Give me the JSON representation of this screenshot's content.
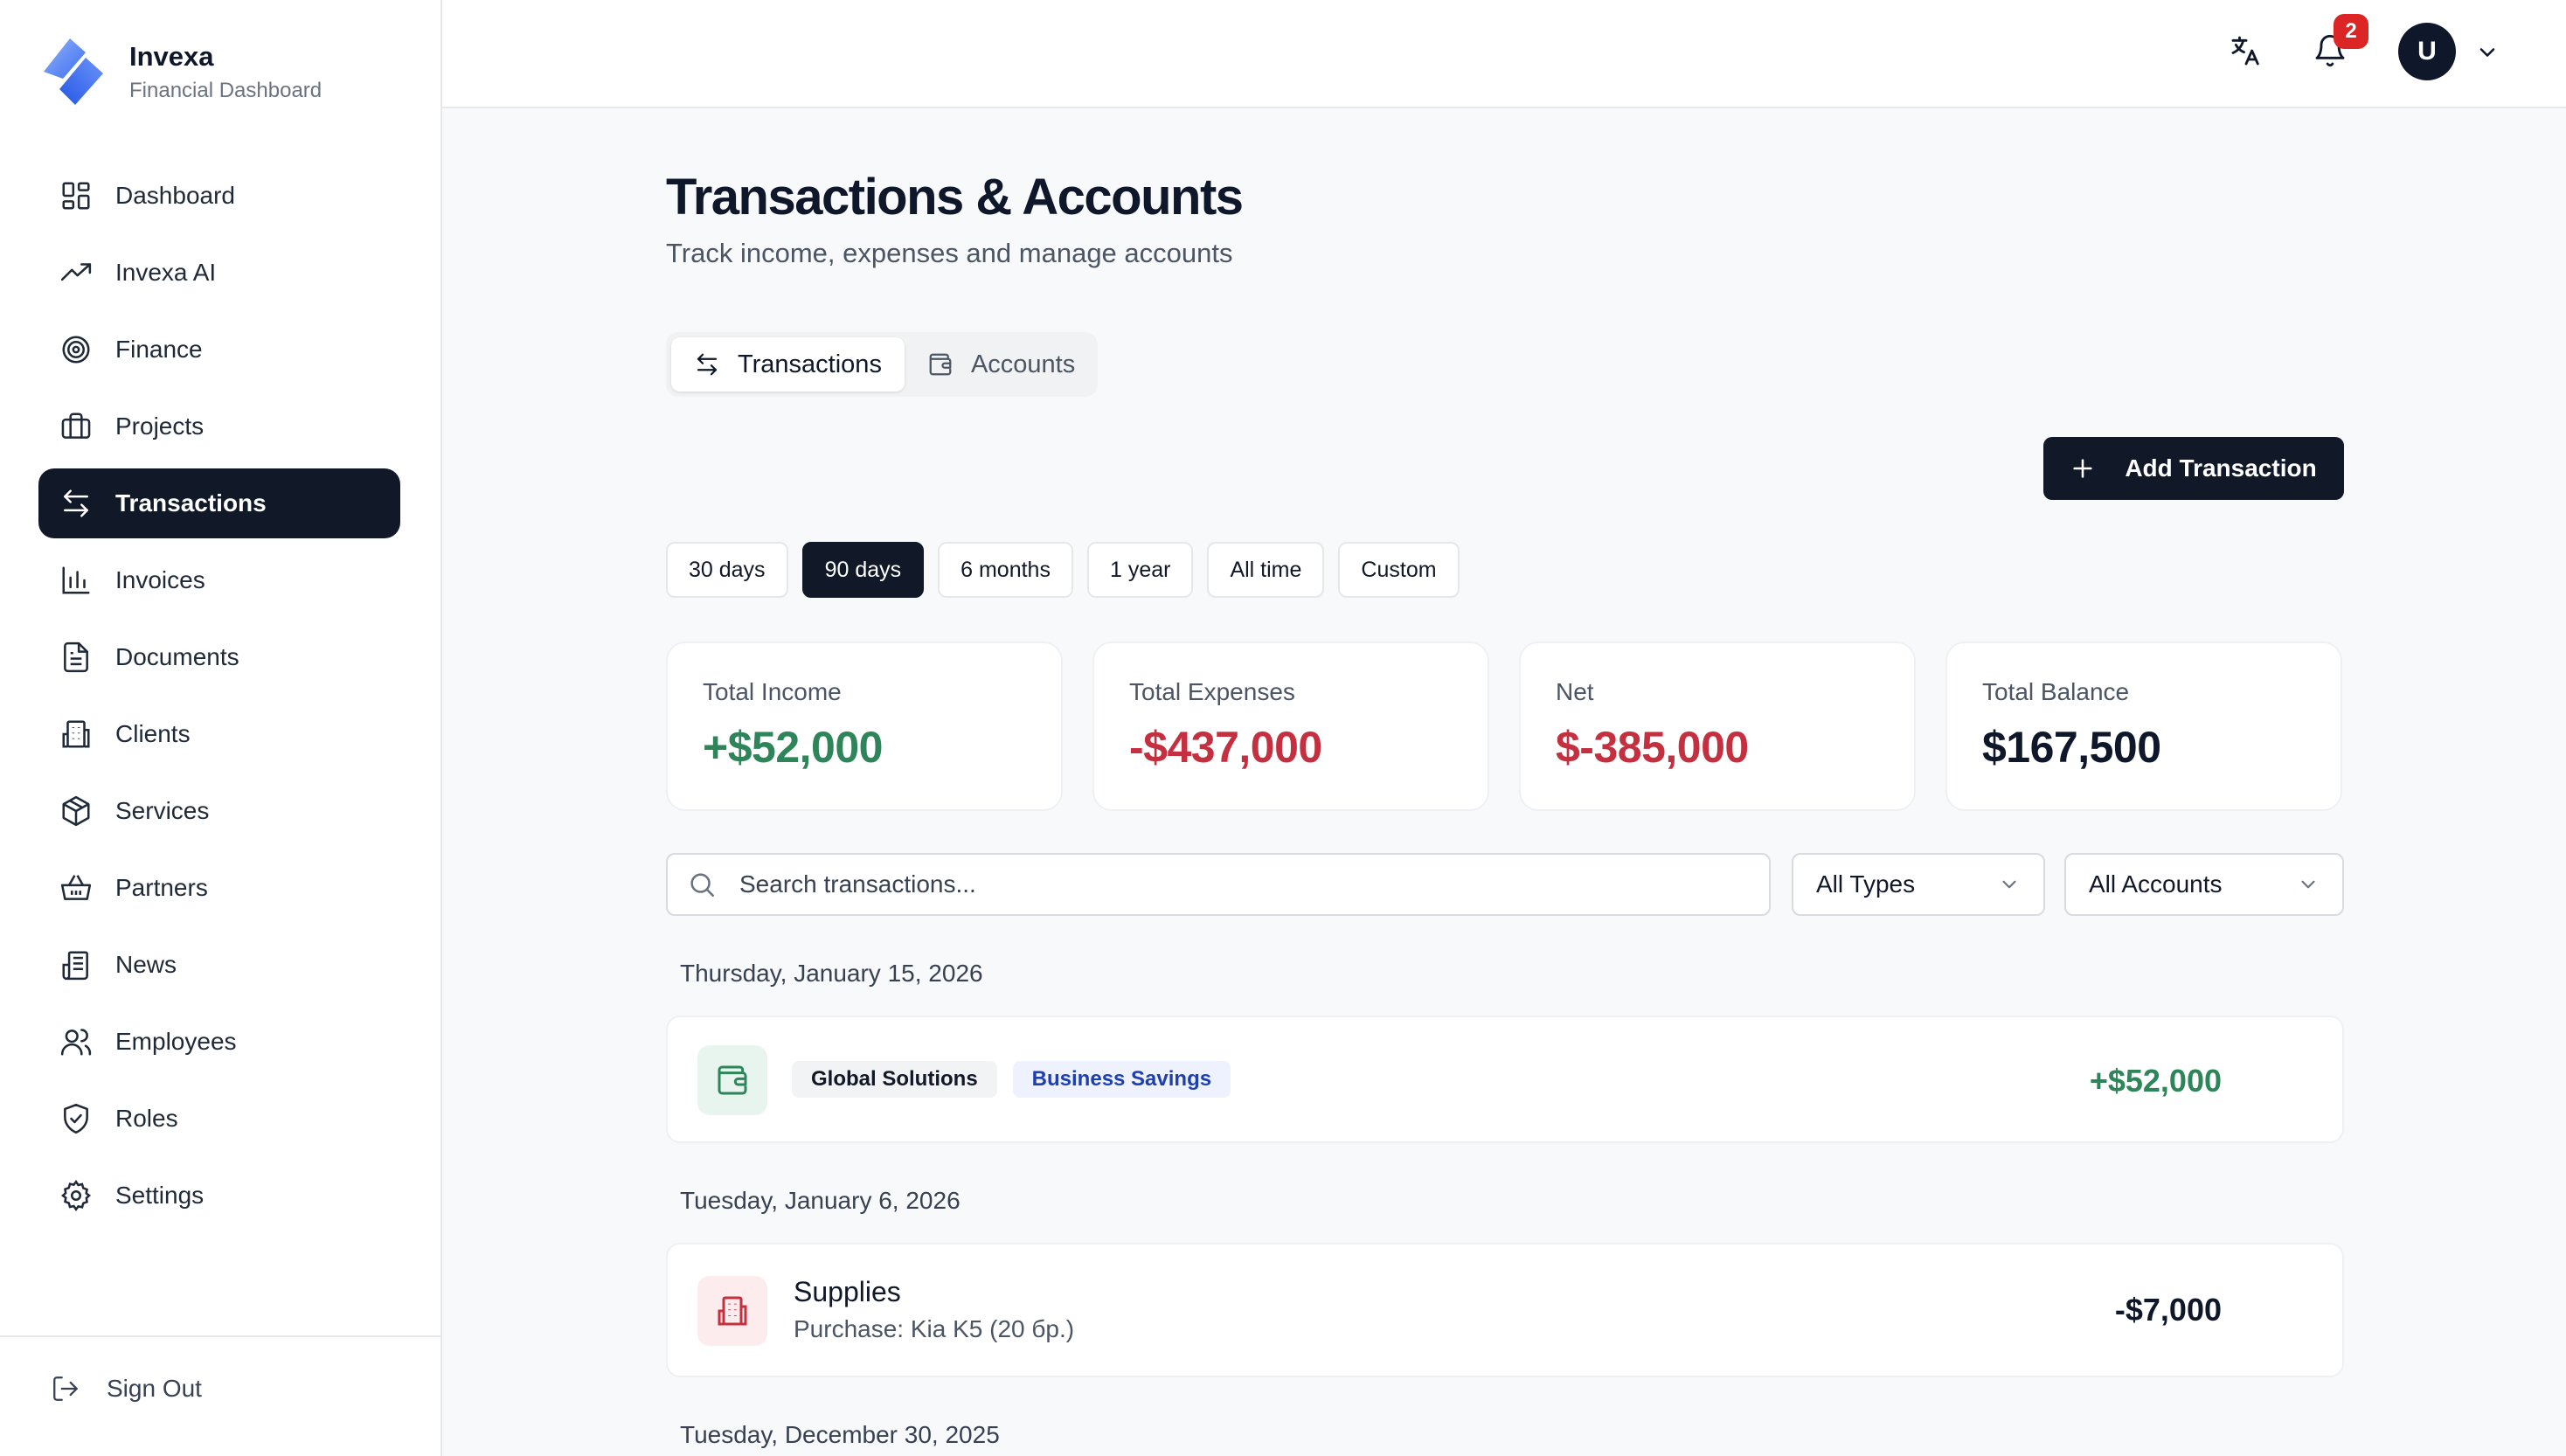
{
  "brand": {
    "name": "Invexa",
    "subtitle": "Financial Dashboard"
  },
  "sidebar": {
    "items": [
      {
        "label": "Dashboard",
        "icon": "dashboard-icon"
      },
      {
        "label": "Invexa AI",
        "icon": "trending-up-icon"
      },
      {
        "label": "Finance",
        "icon": "target-icon"
      },
      {
        "label": "Projects",
        "icon": "briefcase-icon"
      },
      {
        "label": "Transactions",
        "icon": "arrows-left-right-icon",
        "active": true
      },
      {
        "label": "Invoices",
        "icon": "bar-chart-icon"
      },
      {
        "label": "Documents",
        "icon": "document-icon"
      },
      {
        "label": "Clients",
        "icon": "building-icon"
      },
      {
        "label": "Services",
        "icon": "package-icon"
      },
      {
        "label": "Partners",
        "icon": "basket-icon"
      },
      {
        "label": "News",
        "icon": "newspaper-icon"
      },
      {
        "label": "Employees",
        "icon": "users-icon"
      },
      {
        "label": "Roles",
        "icon": "shield-check-icon"
      },
      {
        "label": "Settings",
        "icon": "gear-icon"
      }
    ],
    "sign_out": "Sign Out"
  },
  "topbar": {
    "notification_count": "2",
    "avatar_initial": "U"
  },
  "page": {
    "title": "Transactions & Accounts",
    "subtitle": "Track income, expenses and manage accounts"
  },
  "tabs": [
    {
      "label": "Transactions",
      "active": true
    },
    {
      "label": "Accounts",
      "active": false
    }
  ],
  "add_button": "Add Transaction",
  "periods": [
    {
      "label": "30 days",
      "active": false
    },
    {
      "label": "90 days",
      "active": true
    },
    {
      "label": "6 months",
      "active": false
    },
    {
      "label": "1 year",
      "active": false
    },
    {
      "label": "All time",
      "active": false
    },
    {
      "label": "Custom",
      "active": false
    }
  ],
  "stats": [
    {
      "label": "Total Income",
      "value": "+$52,000",
      "color": "#2f855a"
    },
    {
      "label": "Total Expenses",
      "value": "-$437,000",
      "color": "#c53040"
    },
    {
      "label": "Net",
      "value": "$-385,000",
      "color": "#c53040"
    },
    {
      "label": "Total Balance",
      "value": "$167,500",
      "color": "#0f172a"
    }
  ],
  "filters": {
    "search_placeholder": "Search transactions...",
    "type_select": "All Types",
    "account_select": "All Accounts"
  },
  "groups": [
    {
      "date": "Thursday, January 15, 2026",
      "transactions": [
        {
          "chip_party": "Global Solutions",
          "chip_account": "Business Savings",
          "amount": "+$52,000",
          "amount_color": "#2f855a",
          "icon": "wallet-icon"
        }
      ]
    },
    {
      "date": "Tuesday, January 6, 2026",
      "transactions": [
        {
          "title": "Supplies",
          "description": "Purchase: Kia K5 (20 бр.)",
          "amount": "-$7,000",
          "amount_color": "#0f172a",
          "icon": "building-icon"
        }
      ]
    },
    {
      "date": "Tuesday, December 30, 2025",
      "transactions": []
    }
  ],
  "colors": {
    "primary": "#111827",
    "income": "#2f855a",
    "expense": "#c53040",
    "badge": "#dc2626",
    "account_chip": "#1e40af"
  }
}
